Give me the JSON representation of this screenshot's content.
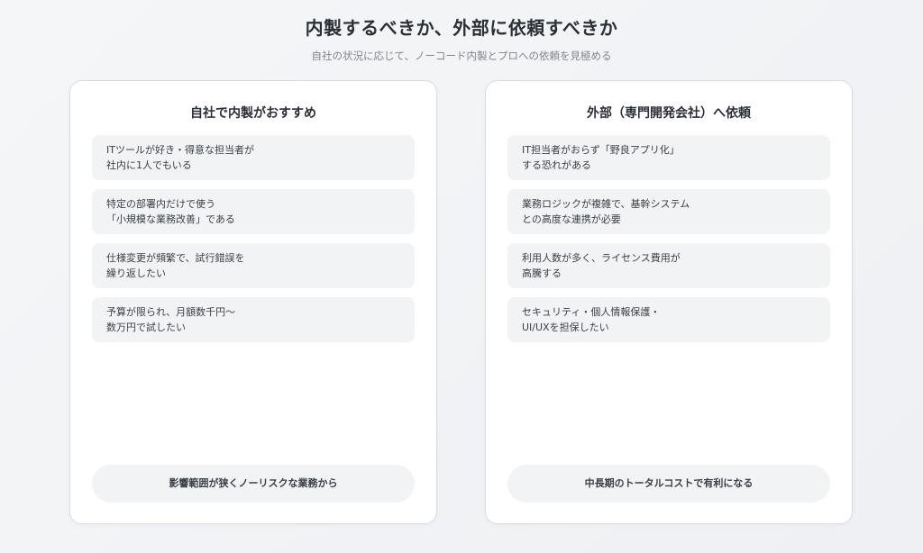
{
  "header": {
    "title": "内製するべきか、外部に依頼すべきか",
    "subtitle": "自社の状況に応じて、ノーコード内製とプロへの依頼を見極める"
  },
  "left_card": {
    "title": "自社で内製がおすすめ",
    "items": [
      {
        "line1": "ITツールが好き・得意な担当者が",
        "line2": "社内に1人でもいる"
      },
      {
        "line1": "特定の部署内だけで使う",
        "line2": "「小規模な業務改善」である"
      },
      {
        "line1": "仕様変更が頻繁で、試行錯誤を",
        "line2": "繰り返したい"
      },
      {
        "line1": "予算が限られ、月額数千円〜",
        "line2": "数万円で試したい"
      }
    ],
    "footer": "影響範囲が狭くノーリスクな業務から"
  },
  "right_card": {
    "title": "外部（専門開発会社）へ依頼",
    "items": [
      {
        "line1": "IT担当者がおらず「野良アプリ化」",
        "line2": "する恐れがある"
      },
      {
        "line1": "業務ロジックが複雑で、基幹システム",
        "line2": "との高度な連携が必要"
      },
      {
        "line1": "利用人数が多く、ライセンス費用が",
        "line2": "高騰する"
      },
      {
        "line1": "セキュリティ・個人情報保護・",
        "line2": "UI/UXを担保したい"
      }
    ],
    "footer": "中長期のトータルコストで有利になる"
  }
}
